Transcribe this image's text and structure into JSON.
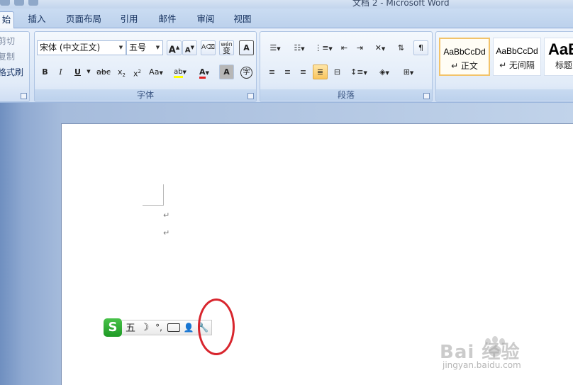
{
  "window": {
    "title": "文档 2 - Microsoft Word"
  },
  "tabs": [
    {
      "label": "始",
      "active": true
    },
    {
      "label": "插入",
      "active": false
    },
    {
      "label": "页面布局",
      "active": false
    },
    {
      "label": "引用",
      "active": false
    },
    {
      "label": "邮件",
      "active": false
    },
    {
      "label": "审阅",
      "active": false
    },
    {
      "label": "视图",
      "active": false
    }
  ],
  "clipboard": {
    "cut": "剪切",
    "copy": "复制",
    "format_painter": "格式刷"
  },
  "font_group": {
    "label": "字体",
    "font_name": "宋体 (中文正文)",
    "font_size": "五号",
    "grow_label": "A",
    "shrink_label": "A",
    "bold": "B",
    "italic": "I",
    "underline": "U",
    "strikethrough": "abc",
    "subscript": "x",
    "superscript": "x",
    "change_case": "Aa",
    "highlight_label": "ab",
    "font_color_label": "A",
    "char_shading_label": "A",
    "wen_label": "wén",
    "wen_char": "变",
    "char_border_label": "A",
    "enclose_char": "字",
    "highlight_color": "#ffff00",
    "font_color": "#e02020"
  },
  "paragraph_group": {
    "label": "段落"
  },
  "styles": [
    {
      "sample": "AaBbCcDd",
      "name": "↵ 正文",
      "selected": true
    },
    {
      "sample": "AaBbCcDd",
      "name": "↵ 无间隔",
      "selected": false
    },
    {
      "sample": "AaB",
      "name": "标题",
      "selected": false
    }
  ],
  "document": {
    "paragraph_mark": "↵"
  },
  "ime_toolbar": {
    "logo": "S",
    "mode": "五",
    "halfwidth": "☽",
    "punct": "°,",
    "user": "👤",
    "settings": "🔧"
  },
  "watermark": {
    "brand": "Bai  经验",
    "url": "jingyan.baidu.com"
  },
  "colors": {
    "ribbon_bg": "#dce8f7",
    "accent": "#f2c36a",
    "highlight_circle": "#d8252d"
  }
}
